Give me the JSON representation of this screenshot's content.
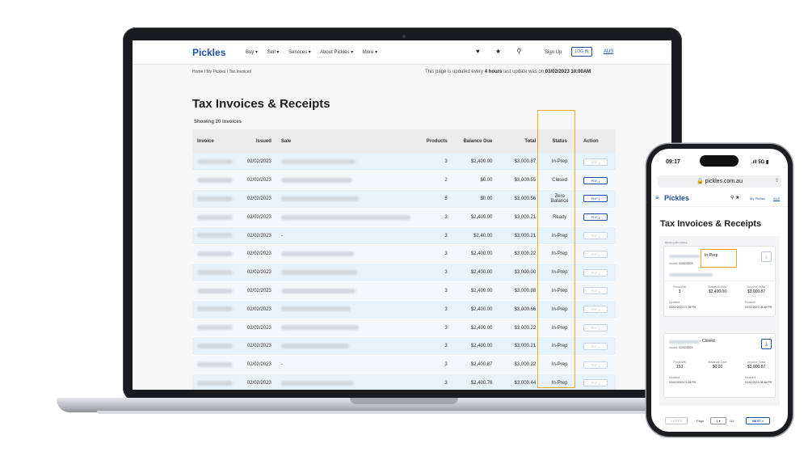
{
  "laptop": {
    "nav": {
      "logo": "Pickles",
      "menu": [
        "Buy ▾",
        "Sell ▾",
        "Services ▾",
        "About Pickles ▾",
        "More ▾"
      ],
      "signup": "Sign Up",
      "login": "LOG IN",
      "region": "AUS"
    },
    "breadcrumb": "Home / My Pickles / Tax Invoices",
    "update_notice": {
      "prefix": "This page is updated every",
      "interval": "4 hours",
      "suffix": "last update was on",
      "timestamp": "03/02/2023 10:00AM"
    },
    "title": "Tax Invoices & Receipts",
    "showing": "Showing 20 invoices",
    "columns": [
      "Invoice",
      "Issued",
      "Sale",
      "Products",
      "Balance Due",
      "Total",
      "Status",
      "Action"
    ],
    "rows": [
      {
        "issued": "02/02/2023",
        "sale": "",
        "products": "3",
        "balance": "$2,400.00",
        "total": "$3,000.87",
        "status": "In-Prep",
        "pdf_active": false
      },
      {
        "issued": "02/02/2023",
        "sale": "",
        "products": "2",
        "balance": "$0.00",
        "total": "$3,000.55",
        "status": "Closed",
        "pdf_active": true
      },
      {
        "issued": "02/02/2023",
        "sale": "",
        "products": "5",
        "balance": "$0.00",
        "total": "$3,000.56",
        "status": "Zero Balance",
        "pdf_active": true
      },
      {
        "issued": "02/02/2023",
        "sale": "",
        "products": "3",
        "balance": "$2,400.00",
        "total": "$3,000.21",
        "status": "Ready",
        "pdf_active": true
      },
      {
        "issued": "02/02/2023",
        "sale": "-",
        "products": "3",
        "balance": "$2,40.00",
        "total": "$3,000.21",
        "status": "In-Prep",
        "pdf_active": false
      },
      {
        "issued": "02/02/2023",
        "sale": "",
        "products": "3",
        "balance": "$2,400.00",
        "total": "$3,000.22",
        "status": "In-Prep",
        "pdf_active": false
      },
      {
        "issued": "02/02/2023",
        "sale": "",
        "products": "3",
        "balance": "$2,400.00",
        "total": "$3,000.00",
        "status": "In-Prep",
        "pdf_active": false
      },
      {
        "issued": "02/02/2023",
        "sale": "",
        "products": "3",
        "balance": "$2,400.00",
        "total": "$3,000.88",
        "status": "In-Prep",
        "pdf_active": false
      },
      {
        "issued": "02/02/2023",
        "sale": "",
        "products": "3",
        "balance": "$2,400.00",
        "total": "$3,000.66",
        "status": "In-Prep",
        "pdf_active": false
      },
      {
        "issued": "02/02/2023",
        "sale": "",
        "products": "3",
        "balance": "$2,400.00",
        "total": "$3,000.22",
        "status": "In-Prep",
        "pdf_active": false
      },
      {
        "issued": "02/02/2023",
        "sale": "",
        "products": "3",
        "balance": "$2,400.00",
        "total": "$3,000.21",
        "status": "In-Prep",
        "pdf_active": false
      },
      {
        "issued": "02/02/2023",
        "sale": "-",
        "products": "3",
        "balance": "$2,400.87",
        "total": "$3,000.22",
        "status": "In-Prep",
        "pdf_active": false
      },
      {
        "issued": "02/02/2023",
        "sale": "",
        "products": "3",
        "balance": "$2,400.76",
        "total": "$3,000.44",
        "status": "In-Prep",
        "pdf_active": false
      }
    ],
    "pdf_label": "PDF ⤓"
  },
  "phone": {
    "time": "09:17",
    "status": ".ıll 5G",
    "url": "🔒 pickles.com.au",
    "logo": "Pickles",
    "my_pickles": "My Pickles",
    "region": "AUS",
    "title": "Tax Invoices & Receipts",
    "showing": "Showing 20 invoices",
    "cards": [
      {
        "status": "In-Prep",
        "meta_label": "Issued:",
        "meta_date": "02/02/2023",
        "products_label": "Products",
        "products": "3",
        "balance_label": "Balance Due",
        "balance": "$2,400.00",
        "total_label": "Invoice Total",
        "total": "$3,000.87",
        "updated_label": "Updated",
        "updated": "02/02/2023 07:28 PM",
        "emailed_label": "Emailed",
        "emailed": "02/02/2023 08:48 PM",
        "dl_active": false
      },
      {
        "status": "- Closed",
        "meta_label": "Issued:",
        "meta_date": "02/02/2023",
        "products_label": "Products",
        "products": "153",
        "balance_label": "Balance Due",
        "balance": "$0.00",
        "total_label": "Invoice Total",
        "total": "$3,000.87",
        "updated_label": "Updated",
        "updated": "02/02/2023 07:28 PM",
        "emailed_label": "Emailed",
        "emailed": "02/02/2023 08:48 PM",
        "dl_active": true
      }
    ],
    "pager": {
      "prev": "< PREV",
      "page_label": "Page",
      "page": "1 ▾",
      "of": "/24",
      "next": "NEXT >"
    }
  },
  "colors": {
    "brand": "#1f4fa3",
    "highlight": "#f4a623"
  }
}
